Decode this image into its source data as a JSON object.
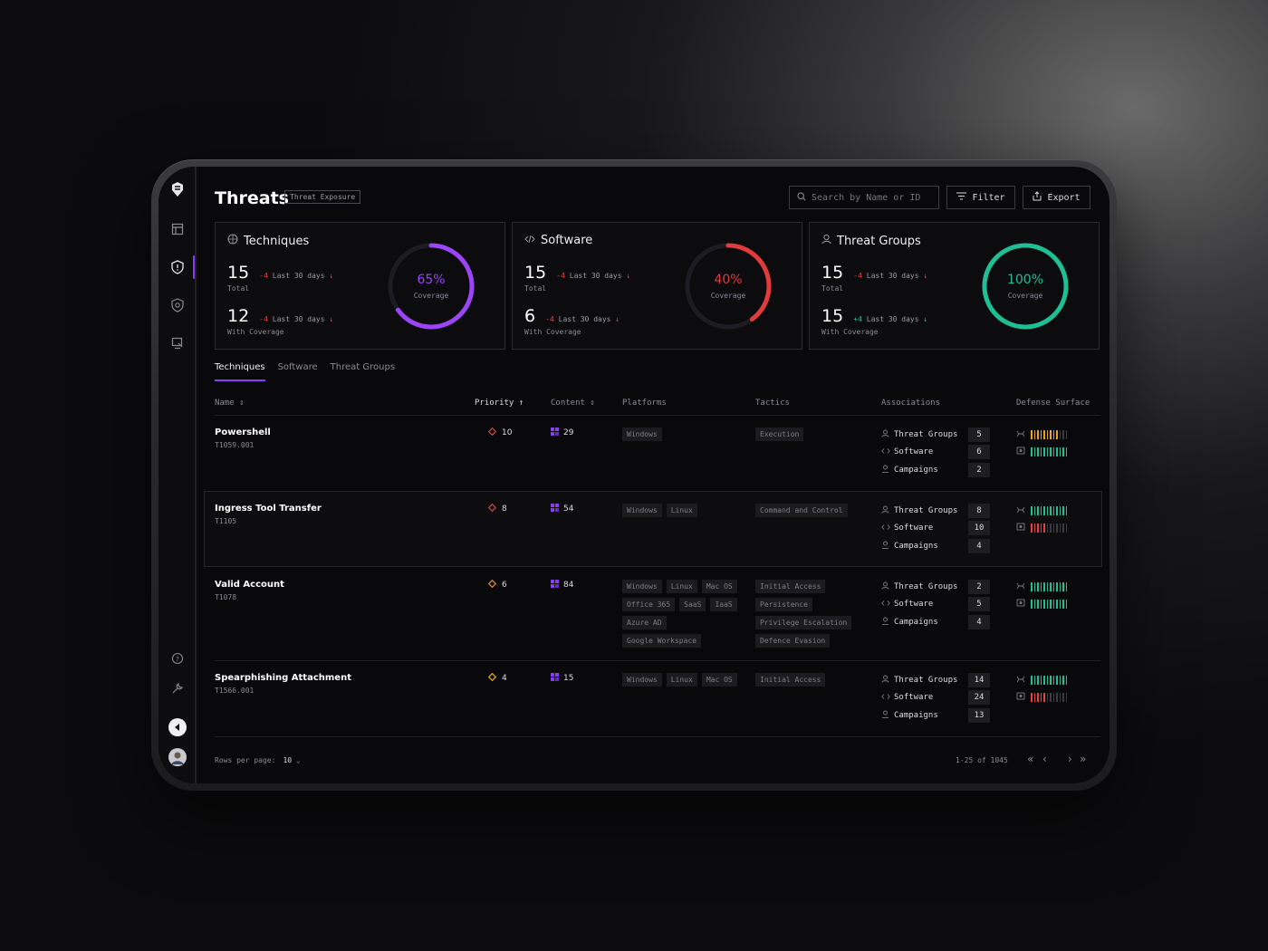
{
  "header": {
    "title": "Threats",
    "badge": "Threat Exposure",
    "search_placeholder": "Search by Name or ID",
    "filter_label": "Filter",
    "export_label": "Export"
  },
  "cards": [
    {
      "title": "Techniques",
      "total": "15",
      "total_delta": "-4",
      "total_period": "Last 30 days",
      "total_sub": "Total",
      "coverage_count": "12",
      "coverage_delta": "-4",
      "coverage_period": "Last 30 days",
      "coverage_sub": "With Coverage",
      "coverage_pct": "65%",
      "coverage_fraction": 0.65,
      "coverage_label": "Coverage",
      "ring_color": "#9b45f7"
    },
    {
      "title": "Software",
      "total": "15",
      "total_delta": "-4",
      "total_period": "Last 30 days",
      "total_sub": "Total",
      "coverage_count": "6",
      "coverage_delta": "-4",
      "coverage_period": "Last 30 days",
      "coverage_sub": "With Coverage",
      "coverage_pct": "40%",
      "coverage_fraction": 0.4,
      "coverage_label": "Coverage",
      "ring_color": "#e23b3b"
    },
    {
      "title": "Threat Groups",
      "total": "15",
      "total_delta": "-4",
      "total_period": "Last 30 days",
      "total_sub": "Total",
      "coverage_count": "15",
      "coverage_delta": "+4",
      "coverage_period": "Last 30 days",
      "coverage_sub": "With Coverage",
      "coverage_pct": "100%",
      "coverage_fraction": 1.0,
      "coverage_label": "Coverage",
      "ring_color": "#1fbf95"
    }
  ],
  "tabs": [
    "Techniques",
    "Software",
    "Threat Groups"
  ],
  "columns": {
    "name": "Name",
    "priority": "Priority",
    "content": "Content",
    "platforms": "Platforms",
    "tactics": "Tactics",
    "associations": "Associations",
    "defense": "Defense Surface"
  },
  "association_labels": [
    "Threat Groups",
    "Software",
    "Campaigns"
  ],
  "rows": [
    {
      "name": "Powershell",
      "id": "T1059.001",
      "priority": "10",
      "priority_color": "#e54040",
      "content": "29",
      "platforms": [
        "Windows"
      ],
      "tactics": [
        "Execution"
      ],
      "assoc": [
        "5",
        "6",
        "2"
      ],
      "defense": [
        {
          "filled": 9,
          "color": "#e8a317"
        },
        {
          "filled": 12,
          "color": "#1fbf95"
        }
      ]
    },
    {
      "name": "Ingress Tool Transfer",
      "id": "T1105",
      "priority": "8",
      "priority_color": "#e54040",
      "content": "54",
      "platforms": [
        "Windows",
        "Linux"
      ],
      "tactics": [
        "Command and Control"
      ],
      "assoc": [
        "8",
        "10",
        "4"
      ],
      "defense": [
        {
          "filled": 12,
          "color": "#1fbf95"
        },
        {
          "filled": 5,
          "color": "#e54040"
        }
      ]
    },
    {
      "name": "Valid Account",
      "id": "T1078",
      "priority": "6",
      "priority_color": "#e8922a",
      "content": "84",
      "platforms": [
        "Windows",
        "Linux",
        "Mac OS",
        "Office 365",
        "SaaS",
        "IaaS",
        "Azure AD",
        "Google Workspace"
      ],
      "tactics": [
        "Initial Access",
        "Persistence",
        "Privilege Escalation",
        "Defence Evasion"
      ],
      "assoc": [
        "2",
        "5",
        "4"
      ],
      "defense": [
        {
          "filled": 12,
          "color": "#1fbf95"
        },
        {
          "filled": 12,
          "color": "#1fbf95"
        }
      ]
    },
    {
      "name": "Spearphishing Attachment",
      "id": "T1566.001",
      "priority": "4",
      "priority_color": "#e8b02a",
      "content": "15",
      "platforms": [
        "Windows",
        "Linux",
        "Mac OS"
      ],
      "tactics": [
        "Initial Access"
      ],
      "assoc": [
        "14",
        "24",
        "13"
      ],
      "defense": [
        {
          "filled": 12,
          "color": "#1fbf95"
        },
        {
          "filled": 5,
          "color": "#e54040"
        }
      ]
    }
  ],
  "footer": {
    "rows_per_page_label": "Rows per page:",
    "rows_per_page_value": "10",
    "range": "1-25 of 1045"
  },
  "colors": {
    "accent": "#8b3cf7",
    "content_icon": "#8b3cf7"
  }
}
